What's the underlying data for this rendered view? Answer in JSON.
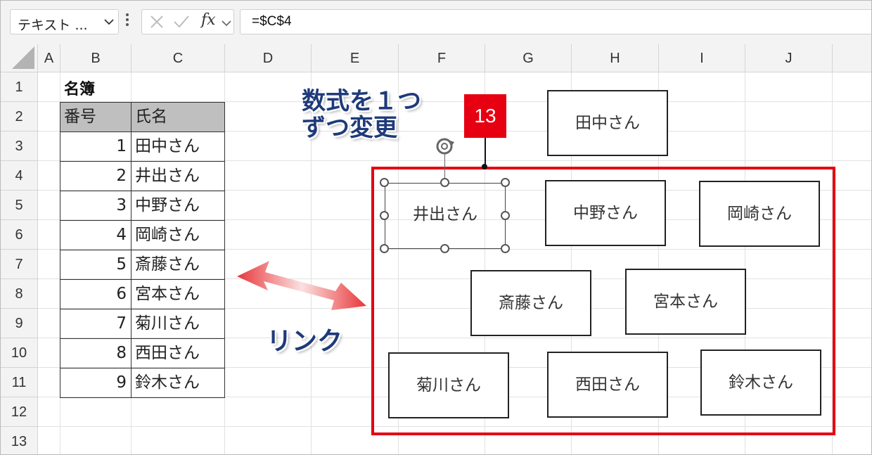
{
  "formula_bar": {
    "name_box": "テキスト ...",
    "fx_label": "fx",
    "formula": "=$C$4"
  },
  "columns": [
    "A",
    "B",
    "C",
    "D",
    "E",
    "F",
    "G",
    "H",
    "I",
    "J"
  ],
  "rows": [
    "1",
    "2",
    "3",
    "4",
    "5",
    "6",
    "7",
    "8",
    "9",
    "10",
    "11",
    "12",
    "13"
  ],
  "table": {
    "title": "名簿",
    "headers": [
      "番号",
      "氏名"
    ],
    "rows": [
      {
        "no": "1",
        "name": "田中さん"
      },
      {
        "no": "2",
        "name": "井出さん"
      },
      {
        "no": "3",
        "name": "中野さん"
      },
      {
        "no": "4",
        "name": "岡崎さん"
      },
      {
        "no": "5",
        "name": "斎藤さん"
      },
      {
        "no": "6",
        "name": "宮本さん"
      },
      {
        "no": "7",
        "name": "菊川さん"
      },
      {
        "no": "8",
        "name": "西田さん"
      },
      {
        "no": "9",
        "name": "鈴木さん"
      }
    ]
  },
  "annotations": {
    "note_line1": "数式を１つ",
    "note_line2": "ずつ変更",
    "badge": "13",
    "link_label": "リンク",
    "accent_color": "#e60012",
    "note_color": "#1f3a7a"
  },
  "shapes": [
    "田中さん",
    "井出さん",
    "中野さん",
    "岡崎さん",
    "斎藤さん",
    "宮本さん",
    "菊川さん",
    "西田さん",
    "鈴木さん"
  ]
}
